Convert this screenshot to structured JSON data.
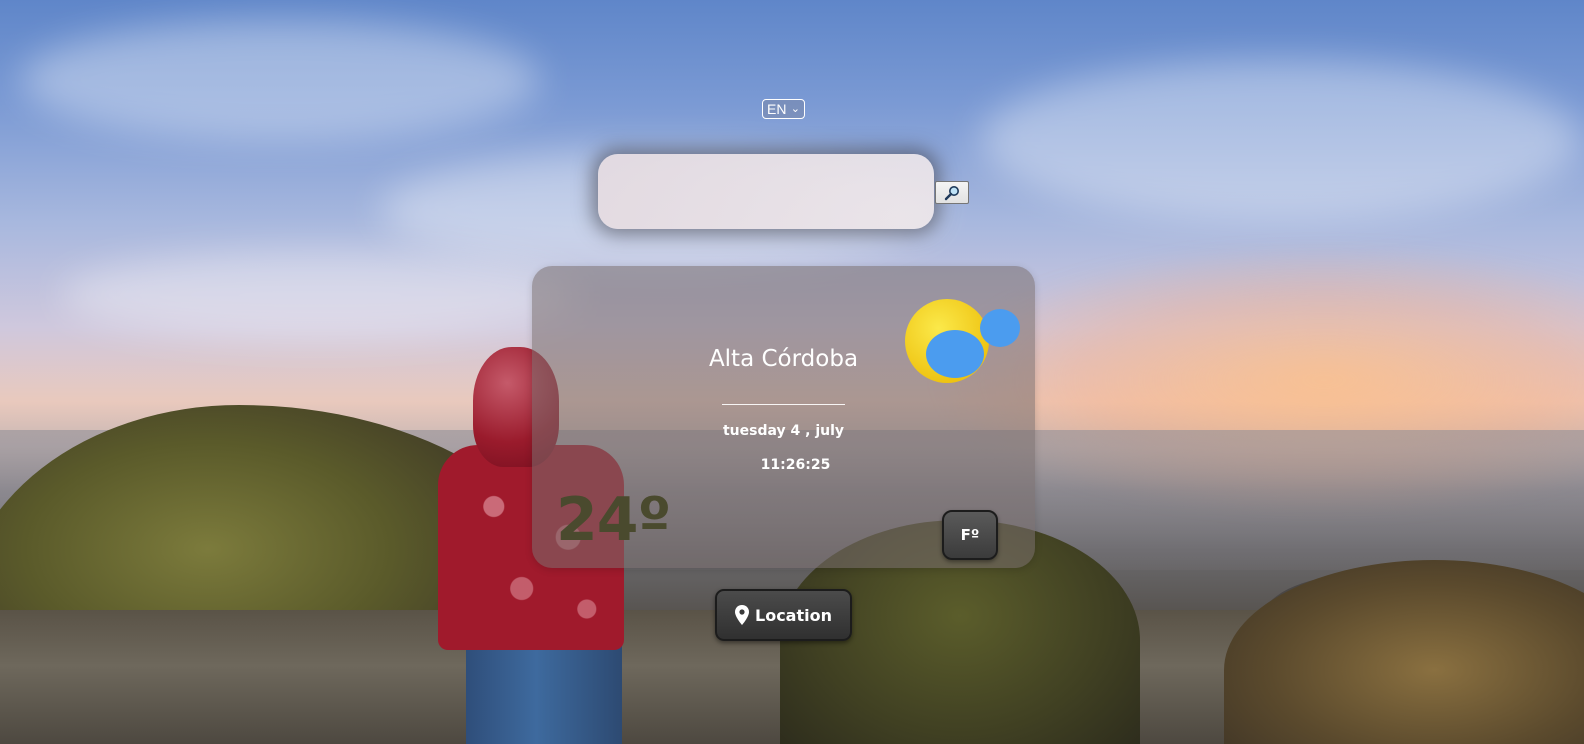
{
  "language_select": {
    "value": "EN"
  },
  "search": {
    "value": "",
    "button_icon": "magnifier-icon"
  },
  "weather": {
    "city": "Alta Córdoba",
    "date": "tuesday 4 , july",
    "time": "11:26:25",
    "temperature": "24º",
    "icon": "sun-cloud-icon",
    "unit_toggle_label": "Fº"
  },
  "location_button": {
    "label": "Location",
    "icon": "map-pin-icon"
  },
  "colors": {
    "sun": "#f7d21a",
    "cloud": "#4b9cef",
    "temperature_text": "#4a4a2e",
    "button_dark": "#3b3b3b"
  }
}
